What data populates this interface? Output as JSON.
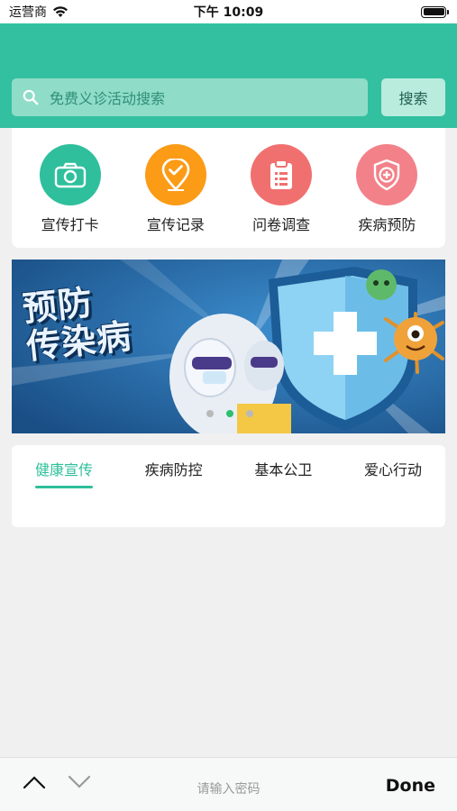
{
  "status_bar": {
    "carrier": "运营商",
    "time": "下午 10:09",
    "battery_level": 1.0
  },
  "search": {
    "placeholder": "免费义诊活动搜索",
    "button_label": "搜索"
  },
  "quick_menu": [
    {
      "label": "宣传打卡",
      "icon": "camera-icon",
      "color": "#2fbf9c"
    },
    {
      "label": "宣传记录",
      "icon": "location-check-icon",
      "color": "#fb9b16"
    },
    {
      "label": "问卷调查",
      "icon": "clipboard-icon",
      "color": "#f0706f"
    },
    {
      "label": "疾病预防",
      "icon": "shield-plus-icon",
      "color": "#f3818a"
    }
  ],
  "banner": {
    "title_line1": "预防",
    "title_line2": "传染病",
    "slide_count": 3,
    "active_slide": 2
  },
  "tabs": {
    "items": [
      "健康宣传",
      "疾病防控",
      "基本公卫",
      "爱心行动"
    ],
    "active": "健康宣传"
  },
  "keyboard_bar": {
    "hint": "请输入密码",
    "done_label": "Done"
  },
  "colors": {
    "primary": "#33c0a0",
    "accent": "#2dbf9a"
  }
}
